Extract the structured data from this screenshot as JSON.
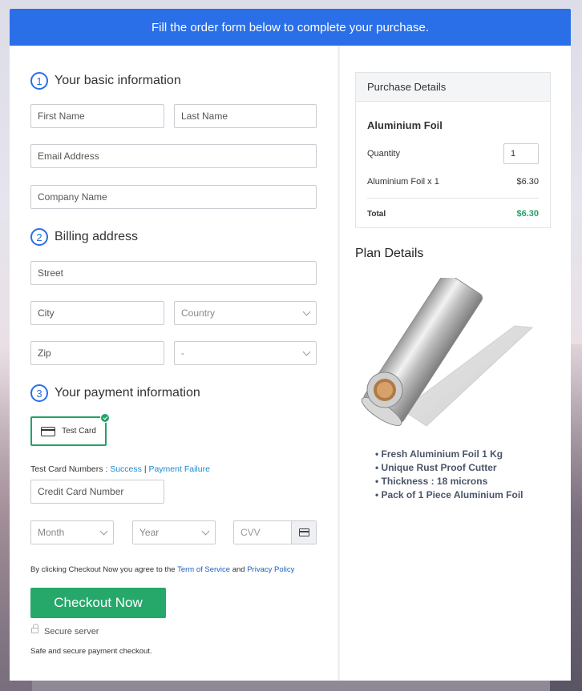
{
  "banner": {
    "text": "Fill the order form below to complete your purchase."
  },
  "sections": {
    "basic": {
      "number": "1",
      "title": "Your basic information"
    },
    "billing": {
      "number": "2",
      "title": "Billing address"
    },
    "payment": {
      "number": "3",
      "title": "Your payment information"
    }
  },
  "basic_fields": {
    "first_name": "First Name",
    "last_name": "Last Name",
    "email": "Email Address",
    "company": "Company Name"
  },
  "billing_fields": {
    "street": "Street",
    "city": "City",
    "country": "Country",
    "zip": "Zip",
    "state": "-"
  },
  "payment": {
    "card_option": "Test Card",
    "test_numbers_label": "Test Card Numbers :",
    "success_link": "Success",
    "separator": "|",
    "failure_link": "Payment Failure",
    "card_number": "Credit Card Number",
    "month": "Month",
    "year": "Year",
    "cvv": "CVV"
  },
  "agreement": {
    "prefix": "By clicking Checkout Now you agree to the",
    "tos": "Term of Service",
    "and": "and",
    "privacy": "Privacy Policy"
  },
  "checkout": {
    "button": "Checkout Now",
    "secure": "Secure server",
    "note": "Safe and secure payment checkout."
  },
  "purchase": {
    "header": "Purchase Details",
    "product": "Aluminium Foil",
    "quantity_label": "Quantity",
    "quantity_value": "1",
    "line_item": "Aluminium Foil x 1",
    "line_price": "$6.30",
    "total_label": "Total",
    "total_value": "$6.30",
    "total_color": "#26a269"
  },
  "plan": {
    "title": "Plan Details",
    "features": [
      "Fresh Aluminium Foil 1 Kg",
      "Unique Rust Proof Cutter",
      "Thickness : 18 microns",
      "Pack of 1 Piece Aluminium Foil"
    ]
  },
  "colors": {
    "accent": "#2a6ee8",
    "cta": "#26a86a",
    "link": "#1a8ad1"
  }
}
